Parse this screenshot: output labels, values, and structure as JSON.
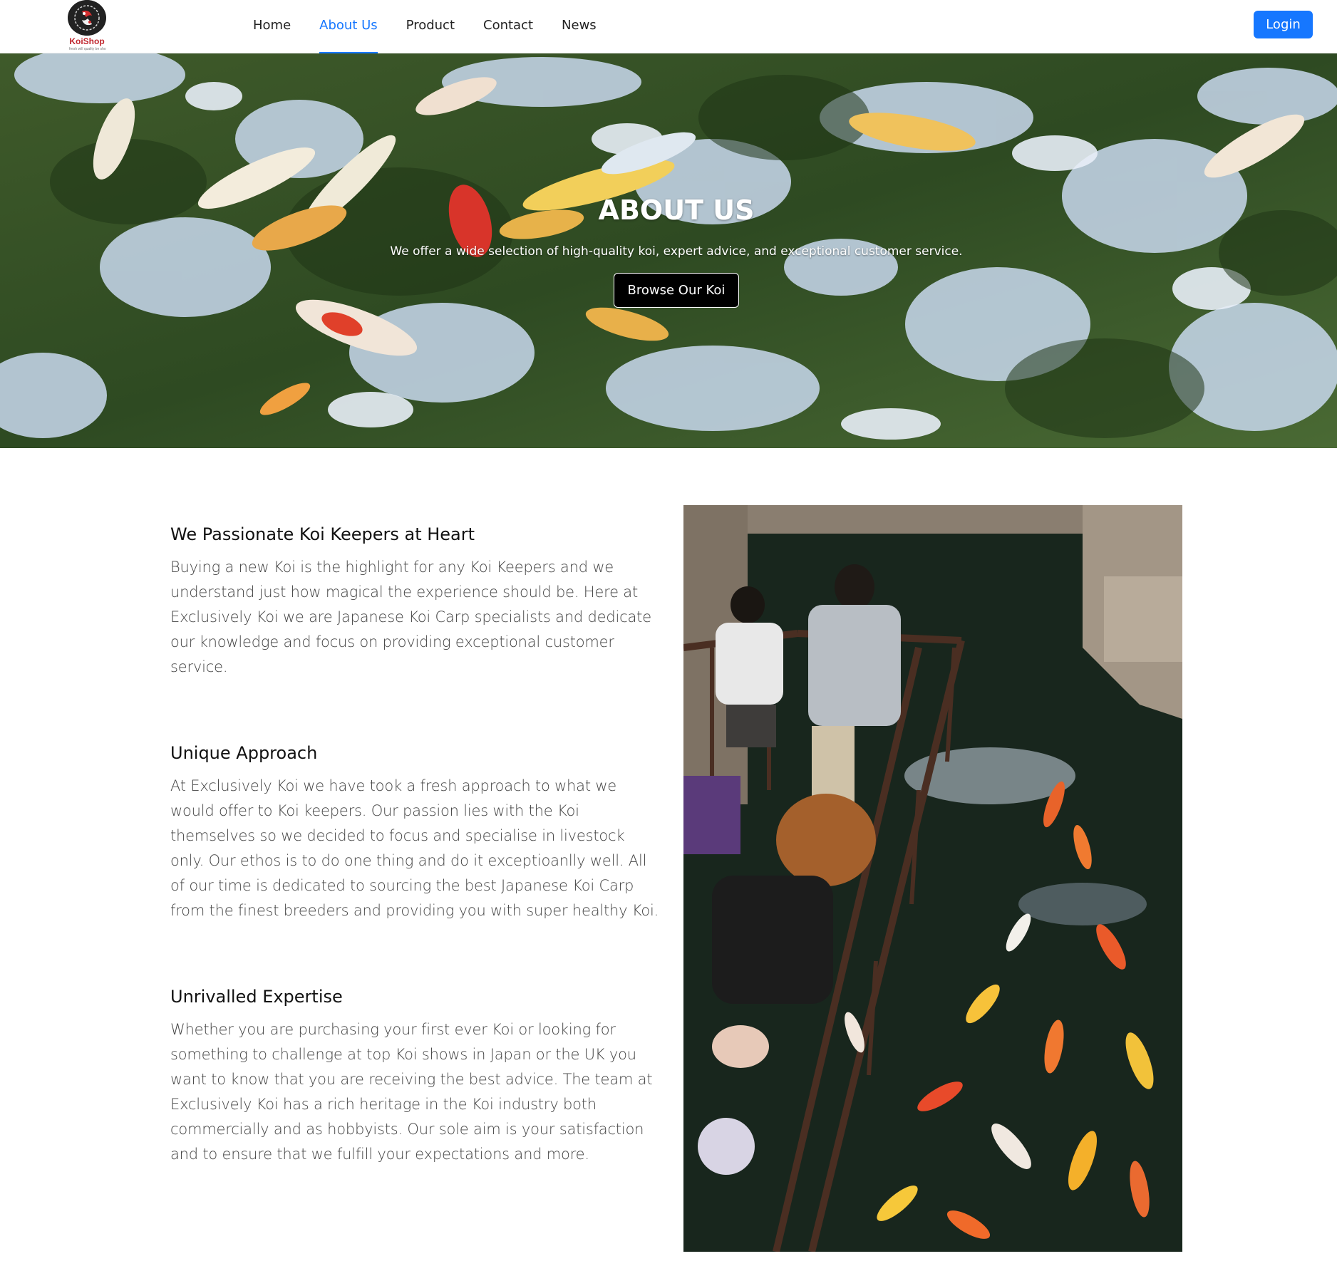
{
  "brand": {
    "name": "KoiShop",
    "tagline": "fresh will quality be shop"
  },
  "nav": {
    "items": [
      {
        "label": "Home"
      },
      {
        "label": "About Us",
        "active": true
      },
      {
        "label": "Product"
      },
      {
        "label": "Contact"
      },
      {
        "label": "News"
      }
    ],
    "login_label": "Login"
  },
  "hero": {
    "title": "ABOUT US",
    "subtitle": "We offer a wide selection of high-quality koi, expert advice, and exceptional customer service.",
    "button_label": "Browse Our Koi"
  },
  "sections": [
    {
      "heading": "We Passionate Koi Keepers at Heart",
      "body": "Buying a new Koi is the highlight for any Koi Keepers and we understand just how magical the experience should be. Here at Exclusively Koi we are Japanese Koi Carp specialists and dedicate our knowledge and focus on providing exceptional customer service."
    },
    {
      "heading": "Unique Approach",
      "body": "At Exclusively Koi we have took a fresh approach to what we would offer to Koi keepers. Our passion lies with the Koi themselves so we decided to focus and specialise in livestock only. Our ethos is to do one thing and do it exceptioanlly well. All of our time is dedicated to sourcing the best Japanese Koi Carp from the finest breeders and providing you with super healthy Koi."
    },
    {
      "heading": "Unrivalled Expertise",
      "body": "Whether you are purchasing your first ever Koi or looking for something to challenge at top Koi shows in Japan or the UK you want to know that you are receiving the best advice. The team at Exclusively Koi has a rich heritage in the Koi industry both commercially and as hobbyists. Our sole aim is your satisfaction and to ensure that we fulfill your expectations and more."
    }
  ],
  "colors": {
    "accent": "#1677ff",
    "brand_red": "#c0262d"
  }
}
